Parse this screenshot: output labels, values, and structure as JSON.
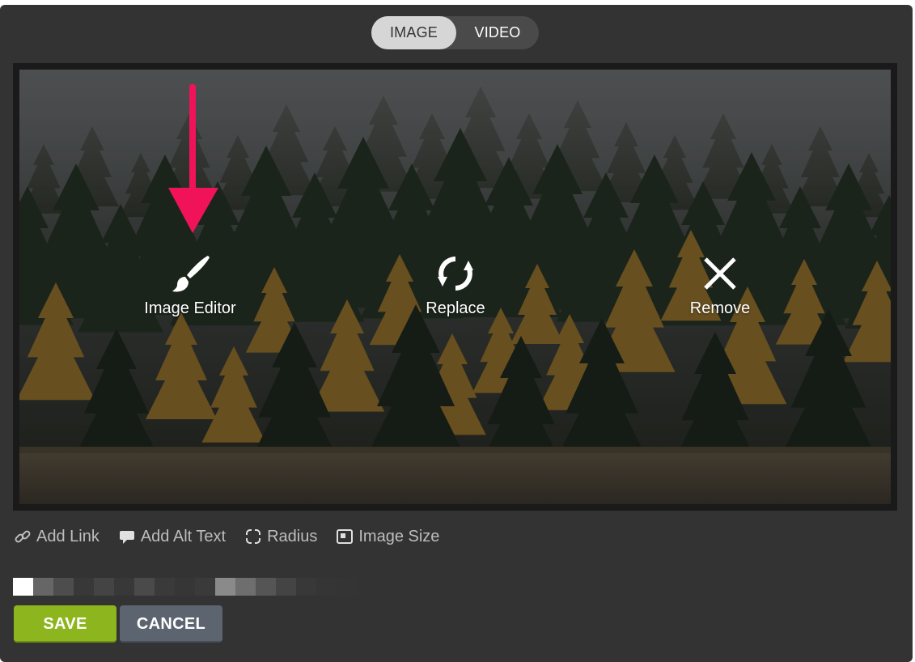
{
  "toggle": {
    "image_label": "IMAGE",
    "video_label": "VIDEO",
    "selected": "IMAGE"
  },
  "overlay": {
    "editor_label": "Image Editor",
    "replace_label": "Replace",
    "remove_label": "Remove"
  },
  "toolbar": {
    "add_link": "Add Link",
    "add_alt_text": "Add Alt Text",
    "radius": "Radius",
    "image_size": "Image Size"
  },
  "actions": {
    "save_label": "SAVE",
    "cancel_label": "CANCEL"
  },
  "colors": {
    "panel": "#333333",
    "save": "#8db51e",
    "cancel": "#5c6470",
    "annotation_arrow": "#f0135a"
  },
  "icons": {
    "editor": "paintbrush-icon",
    "replace": "refresh-icon",
    "remove": "close-icon",
    "link": "link-icon",
    "alt_text": "speech-bubble-icon",
    "radius": "corner-radius-icon",
    "image_size": "image-size-icon"
  }
}
